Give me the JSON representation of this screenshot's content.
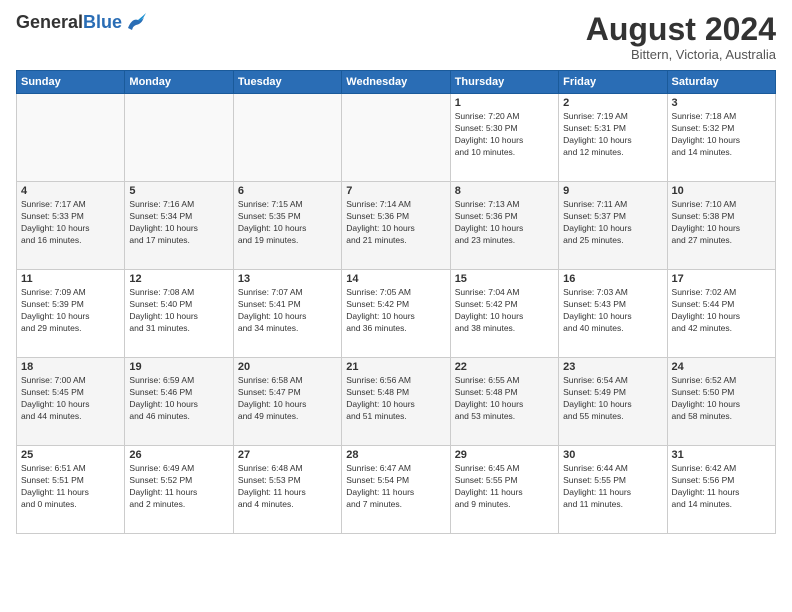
{
  "header": {
    "logo_general": "General",
    "logo_blue": "Blue",
    "month_title": "August 2024",
    "location": "Bittern, Victoria, Australia"
  },
  "weekdays": [
    "Sunday",
    "Monday",
    "Tuesday",
    "Wednesday",
    "Thursday",
    "Friday",
    "Saturday"
  ],
  "weeks": [
    [
      {
        "day": "",
        "info": ""
      },
      {
        "day": "",
        "info": ""
      },
      {
        "day": "",
        "info": ""
      },
      {
        "day": "",
        "info": ""
      },
      {
        "day": "1",
        "info": "Sunrise: 7:20 AM\nSunset: 5:30 PM\nDaylight: 10 hours\nand 10 minutes."
      },
      {
        "day": "2",
        "info": "Sunrise: 7:19 AM\nSunset: 5:31 PM\nDaylight: 10 hours\nand 12 minutes."
      },
      {
        "day": "3",
        "info": "Sunrise: 7:18 AM\nSunset: 5:32 PM\nDaylight: 10 hours\nand 14 minutes."
      }
    ],
    [
      {
        "day": "4",
        "info": "Sunrise: 7:17 AM\nSunset: 5:33 PM\nDaylight: 10 hours\nand 16 minutes."
      },
      {
        "day": "5",
        "info": "Sunrise: 7:16 AM\nSunset: 5:34 PM\nDaylight: 10 hours\nand 17 minutes."
      },
      {
        "day": "6",
        "info": "Sunrise: 7:15 AM\nSunset: 5:35 PM\nDaylight: 10 hours\nand 19 minutes."
      },
      {
        "day": "7",
        "info": "Sunrise: 7:14 AM\nSunset: 5:36 PM\nDaylight: 10 hours\nand 21 minutes."
      },
      {
        "day": "8",
        "info": "Sunrise: 7:13 AM\nSunset: 5:36 PM\nDaylight: 10 hours\nand 23 minutes."
      },
      {
        "day": "9",
        "info": "Sunrise: 7:11 AM\nSunset: 5:37 PM\nDaylight: 10 hours\nand 25 minutes."
      },
      {
        "day": "10",
        "info": "Sunrise: 7:10 AM\nSunset: 5:38 PM\nDaylight: 10 hours\nand 27 minutes."
      }
    ],
    [
      {
        "day": "11",
        "info": "Sunrise: 7:09 AM\nSunset: 5:39 PM\nDaylight: 10 hours\nand 29 minutes."
      },
      {
        "day": "12",
        "info": "Sunrise: 7:08 AM\nSunset: 5:40 PM\nDaylight: 10 hours\nand 31 minutes."
      },
      {
        "day": "13",
        "info": "Sunrise: 7:07 AM\nSunset: 5:41 PM\nDaylight: 10 hours\nand 34 minutes."
      },
      {
        "day": "14",
        "info": "Sunrise: 7:05 AM\nSunset: 5:42 PM\nDaylight: 10 hours\nand 36 minutes."
      },
      {
        "day": "15",
        "info": "Sunrise: 7:04 AM\nSunset: 5:42 PM\nDaylight: 10 hours\nand 38 minutes."
      },
      {
        "day": "16",
        "info": "Sunrise: 7:03 AM\nSunset: 5:43 PM\nDaylight: 10 hours\nand 40 minutes."
      },
      {
        "day": "17",
        "info": "Sunrise: 7:02 AM\nSunset: 5:44 PM\nDaylight: 10 hours\nand 42 minutes."
      }
    ],
    [
      {
        "day": "18",
        "info": "Sunrise: 7:00 AM\nSunset: 5:45 PM\nDaylight: 10 hours\nand 44 minutes."
      },
      {
        "day": "19",
        "info": "Sunrise: 6:59 AM\nSunset: 5:46 PM\nDaylight: 10 hours\nand 46 minutes."
      },
      {
        "day": "20",
        "info": "Sunrise: 6:58 AM\nSunset: 5:47 PM\nDaylight: 10 hours\nand 49 minutes."
      },
      {
        "day": "21",
        "info": "Sunrise: 6:56 AM\nSunset: 5:48 PM\nDaylight: 10 hours\nand 51 minutes."
      },
      {
        "day": "22",
        "info": "Sunrise: 6:55 AM\nSunset: 5:48 PM\nDaylight: 10 hours\nand 53 minutes."
      },
      {
        "day": "23",
        "info": "Sunrise: 6:54 AM\nSunset: 5:49 PM\nDaylight: 10 hours\nand 55 minutes."
      },
      {
        "day": "24",
        "info": "Sunrise: 6:52 AM\nSunset: 5:50 PM\nDaylight: 10 hours\nand 58 minutes."
      }
    ],
    [
      {
        "day": "25",
        "info": "Sunrise: 6:51 AM\nSunset: 5:51 PM\nDaylight: 11 hours\nand 0 minutes."
      },
      {
        "day": "26",
        "info": "Sunrise: 6:49 AM\nSunset: 5:52 PM\nDaylight: 11 hours\nand 2 minutes."
      },
      {
        "day": "27",
        "info": "Sunrise: 6:48 AM\nSunset: 5:53 PM\nDaylight: 11 hours\nand 4 minutes."
      },
      {
        "day": "28",
        "info": "Sunrise: 6:47 AM\nSunset: 5:54 PM\nDaylight: 11 hours\nand 7 minutes."
      },
      {
        "day": "29",
        "info": "Sunrise: 6:45 AM\nSunset: 5:55 PM\nDaylight: 11 hours\nand 9 minutes."
      },
      {
        "day": "30",
        "info": "Sunrise: 6:44 AM\nSunset: 5:55 PM\nDaylight: 11 hours\nand 11 minutes."
      },
      {
        "day": "31",
        "info": "Sunrise: 6:42 AM\nSunset: 5:56 PM\nDaylight: 11 hours\nand 14 minutes."
      }
    ]
  ]
}
